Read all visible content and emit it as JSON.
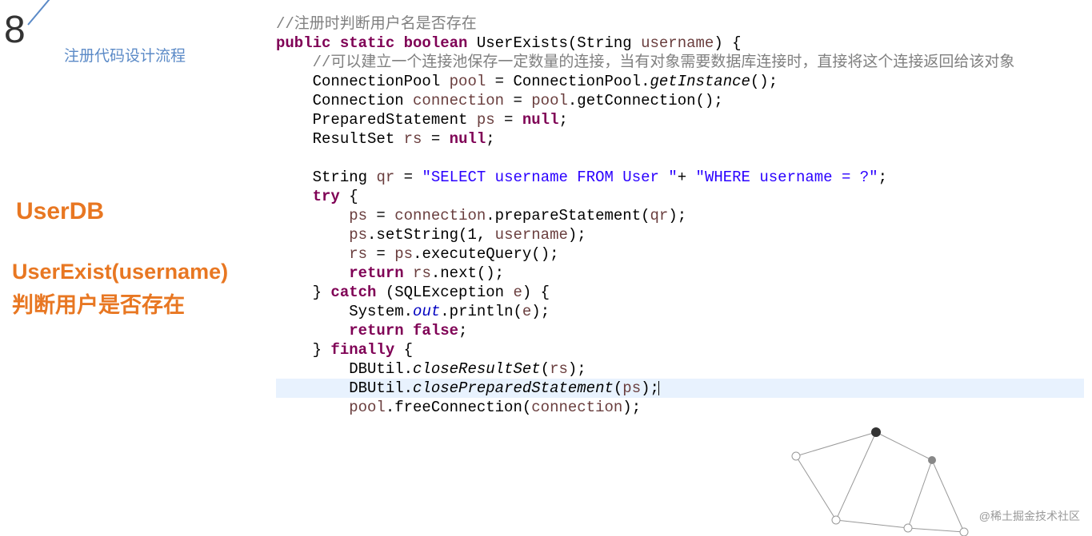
{
  "slide_number": "8",
  "header_label": "注册代码设计流程",
  "sidebar": {
    "userdb": "UserDB",
    "userexist": "UserExist(username)",
    "userexist_desc": "判断用户是否存在"
  },
  "code": {
    "c1": "//注册时判断用户名是否存在",
    "l2_kw": "public static boolean",
    "l2_rest": " UserExists(String ",
    "l2_var": "username",
    "l2_end": ") {",
    "c3": "//可以建立一个连接池保存一定数量的连接，当有对象需要数据库连接时，直接将这个连接返回给该对象",
    "l4_a": "ConnectionPool ",
    "l4_var": "pool",
    "l4_b": " = ConnectionPool.",
    "l4_m": "getInstance",
    "l4_c": "();",
    "l5_a": "Connection ",
    "l5_var": "connection",
    "l5_b": " = ",
    "l5_var2": "pool",
    "l5_c": ".getConnection();",
    "l6_a": "PreparedStatement ",
    "l6_var": "ps",
    "l6_b": " = ",
    "l6_kw": "null",
    "l6_c": ";",
    "l7_a": "ResultSet ",
    "l7_var": "rs",
    "l7_b": " = ",
    "l7_kw": "null",
    "l7_c": ";",
    "l9_a": "String ",
    "l9_var": "qr",
    "l9_b": " = ",
    "l9_s1": "\"SELECT username FROM User \"",
    "l9_c": "+ ",
    "l9_s2": "\"WHERE username = ?\"",
    "l9_d": ";",
    "l10_kw": "try",
    "l10_a": " {",
    "l11_var": "ps",
    "l11_a": " = ",
    "l11_var2": "connection",
    "l11_b": ".prepareStatement(",
    "l11_var3": "qr",
    "l11_c": ");",
    "l12_var": "ps",
    "l12_a": ".setString(1, ",
    "l12_var2": "username",
    "l12_b": ");",
    "l13_var": "rs",
    "l13_a": " = ",
    "l13_var2": "ps",
    "l13_b": ".executeQuery();",
    "l14_kw": "return",
    "l14_a": " ",
    "l14_var": "rs",
    "l14_b": ".next();",
    "l15_a": "} ",
    "l15_kw": "catch",
    "l15_b": " (SQLException ",
    "l15_var": "e",
    "l15_c": ") {",
    "l16_a": "System.",
    "l16_s": "out",
    "l16_b": ".println(",
    "l16_var": "e",
    "l16_c": ");",
    "l17_kw": "return false",
    "l17_a": ";",
    "l18_a": "} ",
    "l18_kw": "finally",
    "l18_b": " {",
    "l19_a": "DBUtil.",
    "l19_m": "closeResultSet",
    "l19_b": "(",
    "l19_var": "rs",
    "l19_c": ");",
    "l20_a": "DBUtil.",
    "l20_m": "closePreparedStatement",
    "l20_b": "(",
    "l20_var": "ps",
    "l20_c": ");",
    "l21_var": "pool",
    "l21_a": ".freeConnection(",
    "l21_var2": "connection",
    "l21_b": ");"
  },
  "watermark": "@稀土掘金技术社区"
}
